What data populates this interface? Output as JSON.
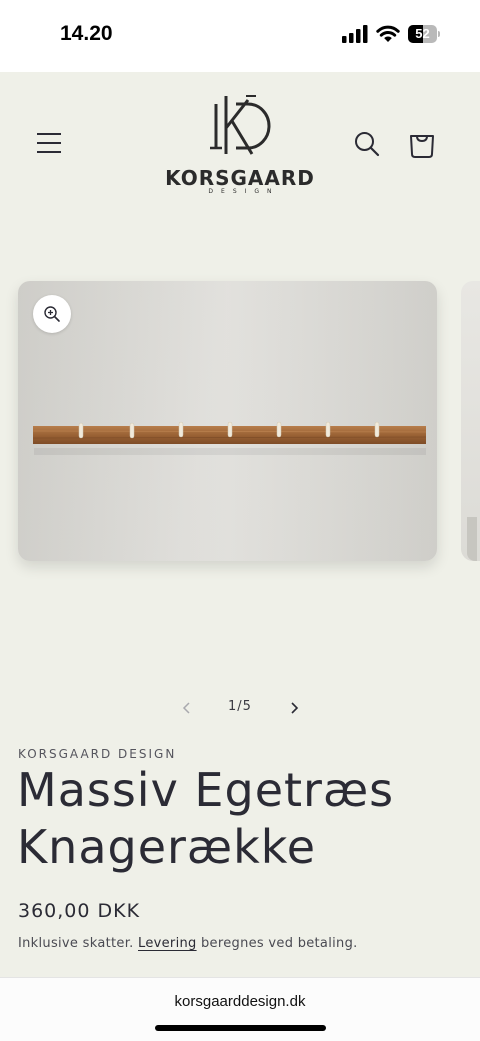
{
  "status_bar": {
    "time": "14.20",
    "battery": "52",
    "battery_level": 0.52
  },
  "header": {
    "logo_name": "KORSGAARD",
    "logo_sub": "DESIGN",
    "menu_icon": "hamburger-menu-icon",
    "search_icon": "search-icon",
    "cart_icon": "cart-icon"
  },
  "gallery": {
    "zoom_icon": "zoom-in-icon",
    "current": "1/5"
  },
  "product": {
    "vendor": "KORSGAARD DESIGN",
    "title": "Massiv Egetræs Knagerække",
    "price": "360,00 DKK",
    "tax_before": "Inklusive skatter. ",
    "tax_link": "Levering",
    "tax_after": " beregnes ved betaling."
  },
  "browser": {
    "url": "korsgaarddesign.dk"
  }
}
